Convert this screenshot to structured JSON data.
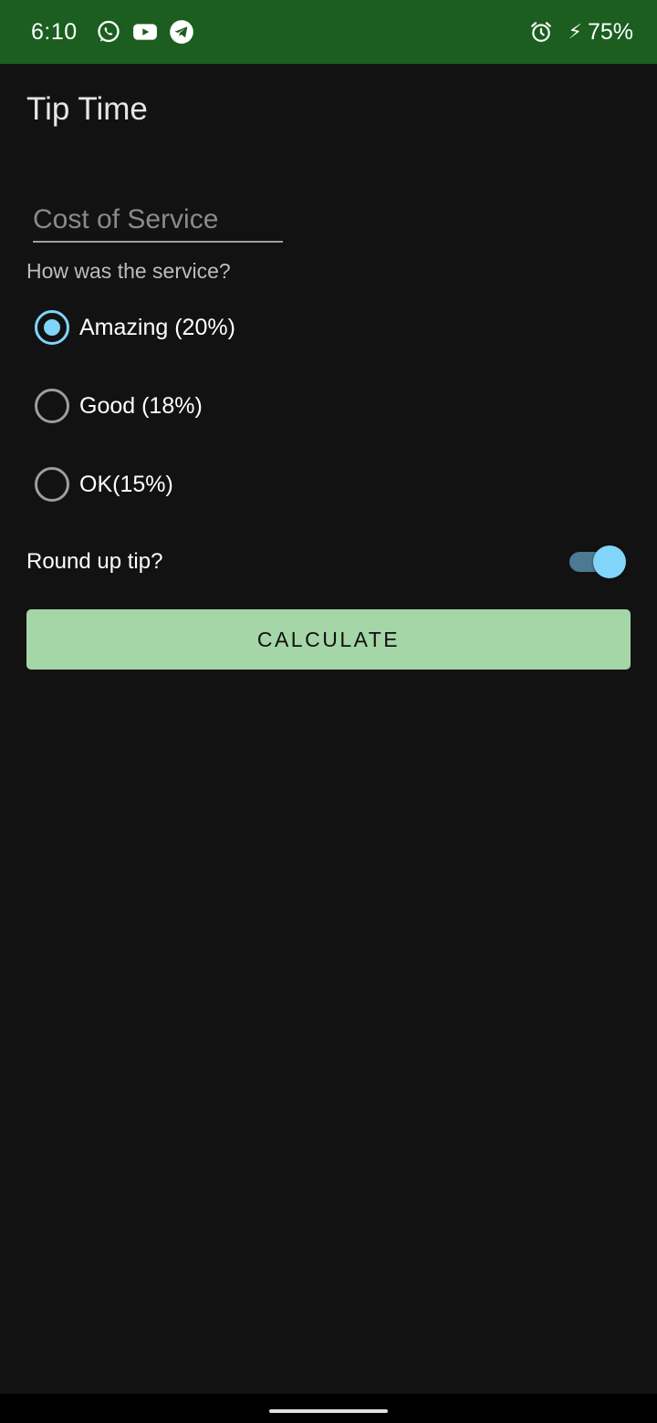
{
  "status_bar": {
    "time": "6:10",
    "notification_icons": [
      "whatsapp-icon",
      "youtube-icon",
      "telegram-icon"
    ],
    "alarm_icon": "alarm-icon",
    "charging_icon": "⚡",
    "battery": "75%",
    "background_color": "#1b5e20"
  },
  "app": {
    "title": "Tip Time"
  },
  "form": {
    "cost_placeholder": "Cost of Service",
    "cost_value": "",
    "question": "How was the service?",
    "options": [
      {
        "label": "Amazing (20%)",
        "checked": true
      },
      {
        "label": "Good (18%)",
        "checked": false
      },
      {
        "label": "OK(15%)",
        "checked": false
      }
    ],
    "round_up_label": "Round up tip?",
    "round_up_on": true,
    "calculate_label": "CALCULATE"
  },
  "colors": {
    "background": "#121212",
    "accent": "#81d4fa",
    "button": "#a5d6a7"
  }
}
